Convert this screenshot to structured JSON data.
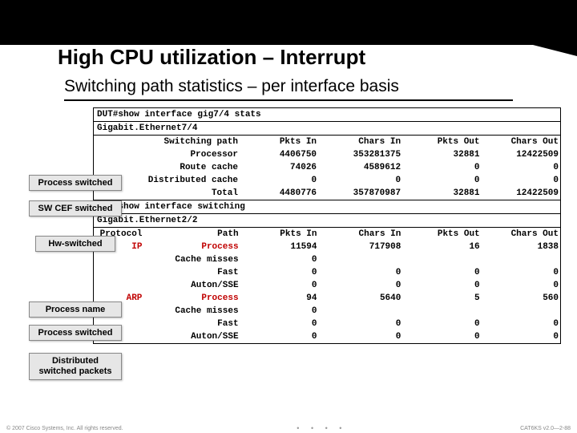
{
  "title": "High CPU utilization – Interrupt",
  "subtitle": "Switching path statistics – per interface basis",
  "cmd1": "DUT#show interface gig7/4 stats",
  "iface1": "Gigabit.Ethernet7/4",
  "hdr": {
    "swpath": "Switching path",
    "pktsin": "Pkts In",
    "charsin": "Chars In",
    "pktsout": "Pkts Out",
    "charsout": "Chars Out",
    "protocol": "Protocol",
    "path": "Path"
  },
  "sec1": {
    "rows": [
      {
        "label": "Processor",
        "pi": "4406750",
        "ci": "353281375",
        "po": "32881",
        "co": "12422509"
      },
      {
        "label": "Route cache",
        "pi": "74026",
        "ci": "4589612",
        "po": "0",
        "co": "0"
      },
      {
        "label": "Distributed cache",
        "pi": "0",
        "ci": "0",
        "po": "0",
        "co": "0"
      },
      {
        "label": "Total",
        "pi": "4480776",
        "ci": "357870987",
        "po": "32881",
        "co": "12422509"
      }
    ]
  },
  "cmd2": "DUT#show interface switching",
  "iface2": "Gigabit.Ethernet2/2",
  "sec2": {
    "rows": [
      {
        "proto": "IP",
        "red_proto": true,
        "path": "Process",
        "red_path": true,
        "pi": "11594",
        "ci": "717908",
        "po": "16",
        "co": "1838"
      },
      {
        "proto": "",
        "path": "Cache misses",
        "pi": "0",
        "ci": "",
        "po": "",
        "co": ""
      },
      {
        "proto": "",
        "path": "Fast",
        "pi": "0",
        "ci": "0",
        "po": "0",
        "co": "0"
      },
      {
        "proto": "",
        "path": "Auton/SSE",
        "pi": "0",
        "ci": "0",
        "po": "0",
        "co": "0"
      },
      {
        "proto": "ARP",
        "red_proto": true,
        "path": "Process",
        "red_path": true,
        "pi": "94",
        "ci": "5640",
        "po": "5",
        "co": "560"
      },
      {
        "proto": "",
        "path": "Cache misses",
        "pi": "0",
        "ci": "",
        "po": "",
        "co": ""
      },
      {
        "proto": "",
        "path": "Fast",
        "pi": "0",
        "ci": "0",
        "po": "0",
        "co": "0"
      },
      {
        "proto": "",
        "path": "Auton/SSE",
        "pi": "0",
        "ci": "0",
        "po": "0",
        "co": "0"
      }
    ]
  },
  "callouts": {
    "process_switched": "Process switched",
    "swcef": "SW CEF switched",
    "hw": "Hw-switched",
    "process_name": "Process name",
    "process_switched2": "Process switched",
    "distributed": "Distributed switched packets"
  },
  "footer": {
    "left": "© 2007 Cisco Systems, Inc. All rights reserved.",
    "right": "CAT6KS v2.0—2-88"
  }
}
